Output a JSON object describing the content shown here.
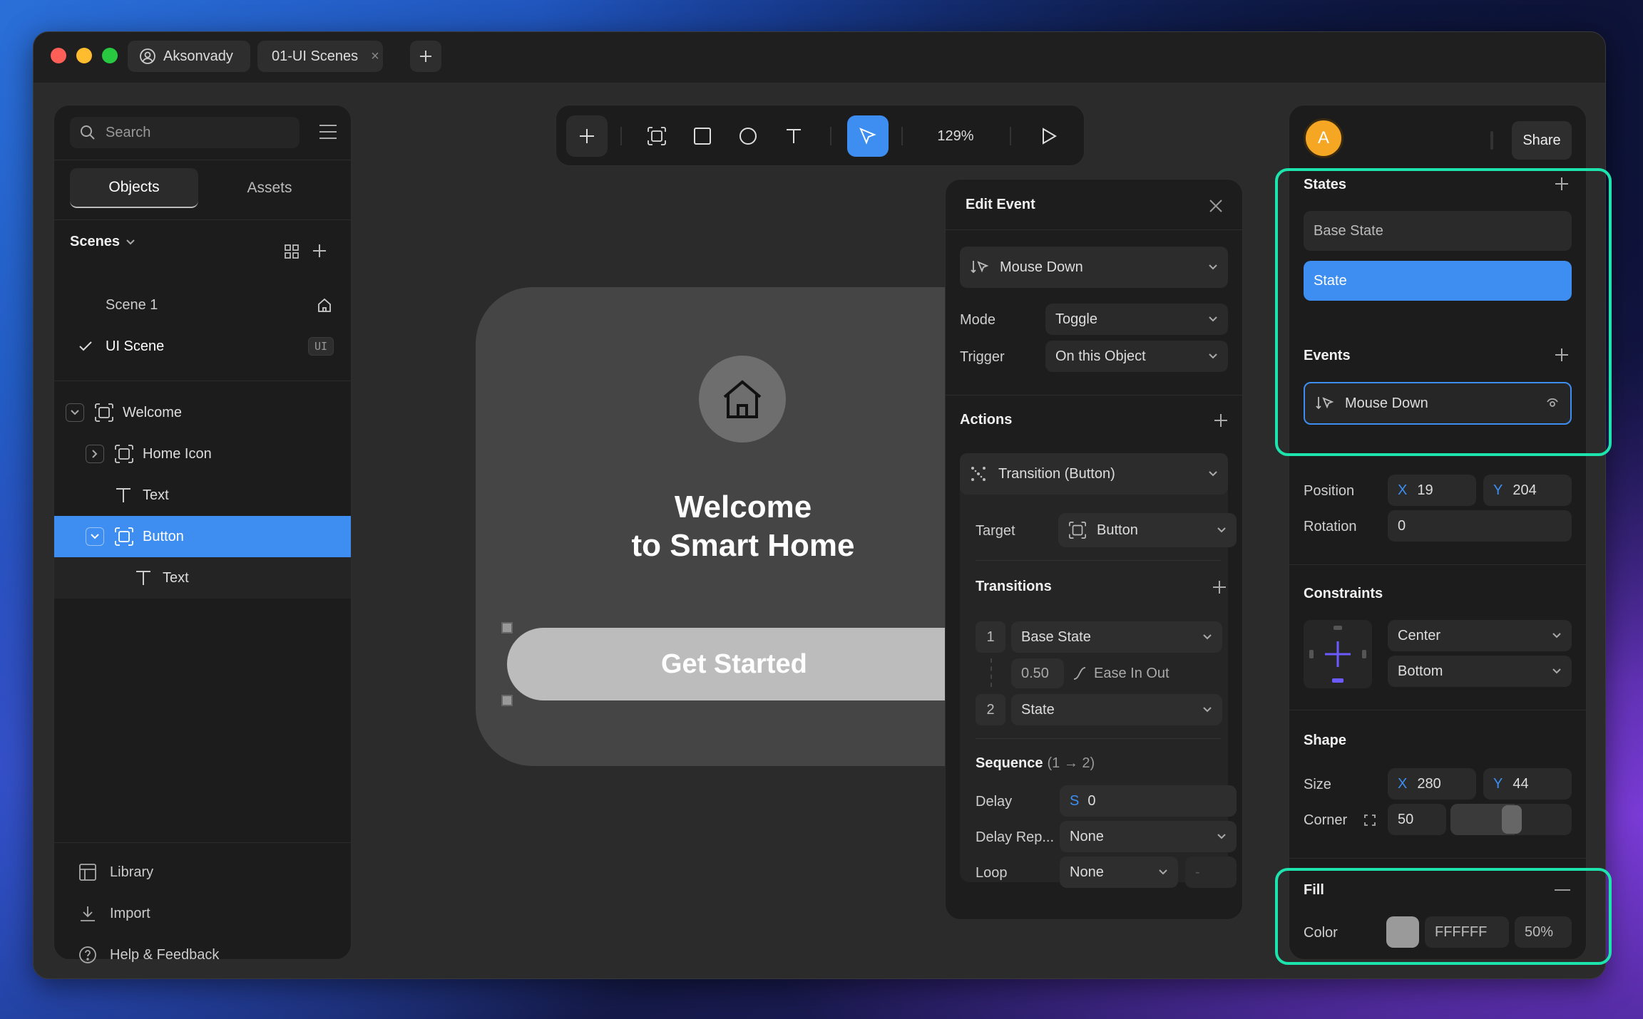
{
  "titlebar": {
    "user_tab": "Aksonvady",
    "file_tab": "01-UI Scenes"
  },
  "left": {
    "search_placeholder": "Search",
    "tabs": [
      "Objects",
      "Assets"
    ],
    "scenes_label": "Scenes",
    "scenes": [
      {
        "name": "Scene 1"
      },
      {
        "name": "UI Scene",
        "badge": "UI"
      }
    ],
    "layers": [
      "Welcome",
      "Home Icon",
      "Text",
      "Button",
      "Text"
    ],
    "footer": [
      "Library",
      "Import",
      "Help & Feedback"
    ]
  },
  "toolbar": {
    "zoom": "129%"
  },
  "canvas": {
    "title_line1": "Welcome",
    "title_line2": "to Smart Home",
    "button_label": "Get Started"
  },
  "event": {
    "title": "Edit Event",
    "event_type": "Mouse Down",
    "mode_label": "Mode",
    "mode_value": "Toggle",
    "trigger_label": "Trigger",
    "trigger_value": "On this Object",
    "actions_label": "Actions",
    "action_value": "Transition (Button)",
    "target_label": "Target",
    "target_value": "Button",
    "transitions_label": "Transitions",
    "t1_num": "1",
    "t1_state": "Base State",
    "t_duration": "0.50",
    "t_ease": "Ease In Out",
    "t2_num": "2",
    "t2_state": "State",
    "sequence_label": "Sequence",
    "sequence_sub": "(1 → 2)",
    "delay_label": "Delay",
    "delay_unit": "S",
    "delay_value": "0",
    "delayrep_label": "Delay Rep...",
    "delayrep_value": "None",
    "loop_label": "Loop",
    "loop_value": "None",
    "loop_extra": "-"
  },
  "right": {
    "avatar": "A",
    "share": "Share",
    "states_label": "States",
    "states": [
      "Base State",
      "State"
    ],
    "events_label": "Events",
    "event_item": "Mouse Down",
    "position_label": "Position",
    "pos_x_label": "X",
    "pos_x": "19",
    "pos_y_label": "Y",
    "pos_y": "204",
    "rotation_label": "Rotation",
    "rotation": "0",
    "constraints_label": "Constraints",
    "constraint_h": "Center",
    "constraint_v": "Bottom",
    "shape_label": "Shape",
    "size_label": "Size",
    "size_x_label": "X",
    "size_x": "280",
    "size_y_label": "Y",
    "size_y": "44",
    "corner_label": "Corner",
    "corner": "50",
    "fill_label": "Fill",
    "color_label": "Color",
    "color_hex": "FFFFFF",
    "color_opacity": "50%"
  },
  "colors": {
    "accent": "#3d8ef0",
    "highlight": "#1de3ad",
    "avatar": "#f5a623"
  }
}
